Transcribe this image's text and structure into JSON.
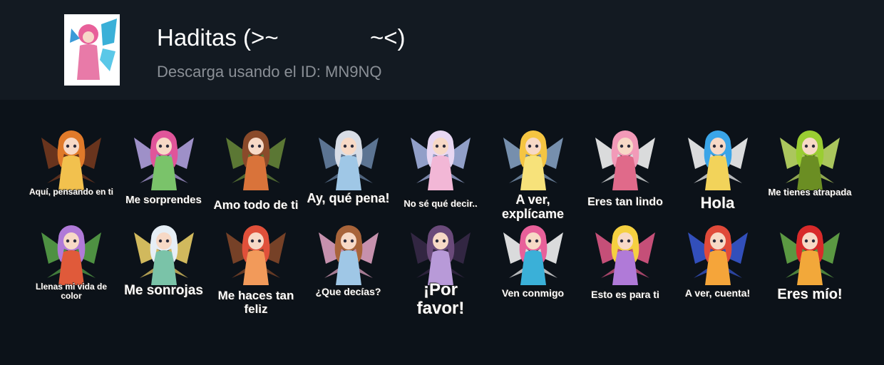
{
  "header": {
    "title": "Haditas (>~              ~<)",
    "subtitle": "Descarga usando el ID: MN9NQ",
    "icon": "fairy-pack-icon"
  },
  "stickers": [
    {
      "caption": "Aquí, pensando en ti",
      "icon": "autumn-fairy-sticker",
      "colors": [
        "#e07a2a",
        "#f2c14e",
        "#7a3b1f"
      ]
    },
    {
      "caption": "Me sorprendes",
      "icon": "pink-hair-fairy-sticker",
      "colors": [
        "#e0559a",
        "#7ac36a",
        "#b9a7e8"
      ]
    },
    {
      "caption": "Amo todo de ti",
      "icon": "forest-fairy-sticker",
      "colors": [
        "#8a4a2a",
        "#d9733a",
        "#6a8a3a"
      ]
    },
    {
      "caption": "Ay, qué pena!",
      "icon": "silver-hair-fairy-sticker",
      "colors": [
        "#d8dde6",
        "#9fc7e6",
        "#6b86a8"
      ]
    },
    {
      "caption": "No sé qué decir..",
      "icon": "winged-angel-fairy-sticker",
      "colors": [
        "#e8d7f2",
        "#f2b7d6",
        "#a9b8e8"
      ]
    },
    {
      "caption": "A ver, explícame",
      "icon": "yellow-fairy-sticker",
      "colors": [
        "#f5c542",
        "#f7e27a",
        "#8aa6c8"
      ]
    },
    {
      "caption": "Eres tan lindo",
      "icon": "pink-dress-fairy-sticker",
      "colors": [
        "#f29ab8",
        "#e06a8a",
        "#ffffff"
      ]
    },
    {
      "caption": "Hola",
      "icon": "blue-hair-fairy-sticker",
      "colors": [
        "#3aa5e8",
        "#f2d35a",
        "#ffffff"
      ]
    },
    {
      "caption": "Me tienes atrapada",
      "icon": "green-fairy-sticker",
      "colors": [
        "#9acd32",
        "#6b8e23",
        "#c8e66a"
      ]
    },
    {
      "caption": "Llenas mi vida de color",
      "icon": "rainbow-fairy-sticker",
      "colors": [
        "#b07ad8",
        "#e05a3a",
        "#5aa84a"
      ]
    },
    {
      "caption": "Me sonrojas",
      "icon": "white-hair-fairy-sticker",
      "colors": [
        "#e6eef5",
        "#7ac3a8",
        "#f5d76a"
      ]
    },
    {
      "caption": "Me haces tan feliz",
      "icon": "strawberry-fairy-sticker",
      "colors": [
        "#e0503a",
        "#f29a5a",
        "#8a4a2a"
      ]
    },
    {
      "caption": "¿Que decías?",
      "icon": "brown-hair-fairy-sticker",
      "colors": [
        "#a8643a",
        "#9fc7e6",
        "#e8a8c8"
      ]
    },
    {
      "caption": "¡Por favor!",
      "icon": "dark-fairy-sticker",
      "colors": [
        "#6a4a7a",
        "#b89ad8",
        "#3a2a4a"
      ]
    },
    {
      "caption": "Ven conmigo",
      "icon": "blue-wing-fairy-sticker",
      "colors": [
        "#e8609a",
        "#3ab0d8",
        "#ffffff"
      ]
    },
    {
      "caption": "Esto es para ti",
      "icon": "blonde-fairy-sticker",
      "colors": [
        "#f5d040",
        "#b07ad8",
        "#e65a8a"
      ]
    },
    {
      "caption": "A ver, cuenta!",
      "icon": "red-dress-fairy-sticker",
      "colors": [
        "#e04a3a",
        "#f5a53a",
        "#3a5ad8"
      ]
    },
    {
      "caption": "Eres mío!",
      "icon": "fire-fairy-sticker",
      "colors": [
        "#d82a2a",
        "#f2a83a",
        "#6ab04a"
      ]
    }
  ]
}
